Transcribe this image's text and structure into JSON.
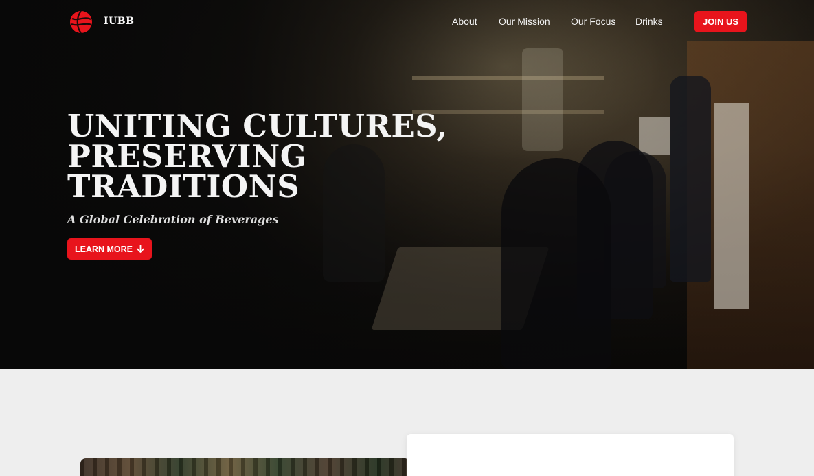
{
  "brand": {
    "name": "IUBB",
    "logo_icon": "red-globe-logo-icon",
    "accent": "#e8141c"
  },
  "nav": {
    "links": [
      "About",
      "Our Mission",
      "Our Focus",
      "Drinks"
    ],
    "cta_label": "JOIN US"
  },
  "hero": {
    "headline_lines": [
      "UNITING CULTURES,",
      "PRESERVING",
      "TRADITIONS"
    ],
    "tagline": "A Global Celebration of Beverages",
    "button_label": "LEARN MORE",
    "button_icon": "arrow-down-icon"
  }
}
